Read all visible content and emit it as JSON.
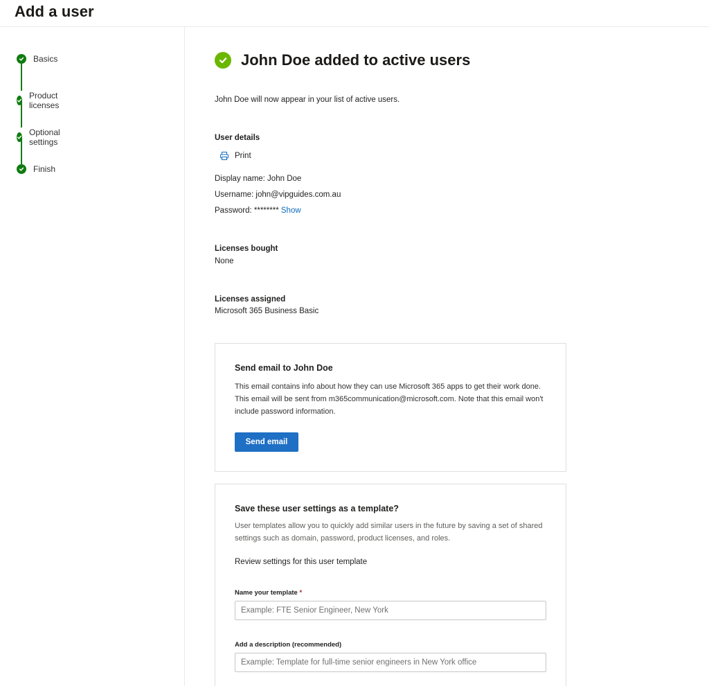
{
  "page": {
    "title": "Add a user"
  },
  "steps": [
    {
      "label": "Basics"
    },
    {
      "label": "Product licenses"
    },
    {
      "label": "Optional settings"
    },
    {
      "label": "Finish"
    }
  ],
  "success": {
    "title": "John Doe added to active users",
    "subtitle": "John Doe will now appear in your list of active users."
  },
  "user_details": {
    "heading": "User details",
    "print_label": "Print",
    "display_name": "Display name: John Doe",
    "username": "Username: john@vipguides.com.au",
    "password_label": "Password: ********",
    "show_label": "Show"
  },
  "licenses_bought": {
    "heading": "Licenses bought",
    "value": "None"
  },
  "licenses_assigned": {
    "heading": "Licenses assigned",
    "value": "Microsoft 365 Business Basic"
  },
  "email_card": {
    "title": "Send email to John Doe",
    "body": "This email contains info about how they can use Microsoft 365 apps to get their work done. This email will be sent from m365communication@microsoft.com. Note that this email won't include password information.",
    "button": "Send email"
  },
  "template_card": {
    "title": "Save these user settings as a template?",
    "body": "User templates allow you to quickly add similar users in the future by saving a set of shared settings such as domain, password, product licenses, and roles.",
    "review_link": "Review settings for this user template",
    "name_label": "Name your template",
    "name_required": "*",
    "name_placeholder": "Example: FTE Senior Engineer, New York",
    "desc_label": "Add a description (recommended)",
    "desc_placeholder": "Example: Template for full-time senior engineers in New York office"
  },
  "colors": {
    "accent": "#1f6fc5",
    "step_green": "#107c10",
    "success_green": "#6bb700",
    "link": "#0f6cbd"
  },
  "icons": {
    "step": "checkmark-circle-icon",
    "success": "checkmark-circle-icon",
    "print": "printer-icon"
  }
}
